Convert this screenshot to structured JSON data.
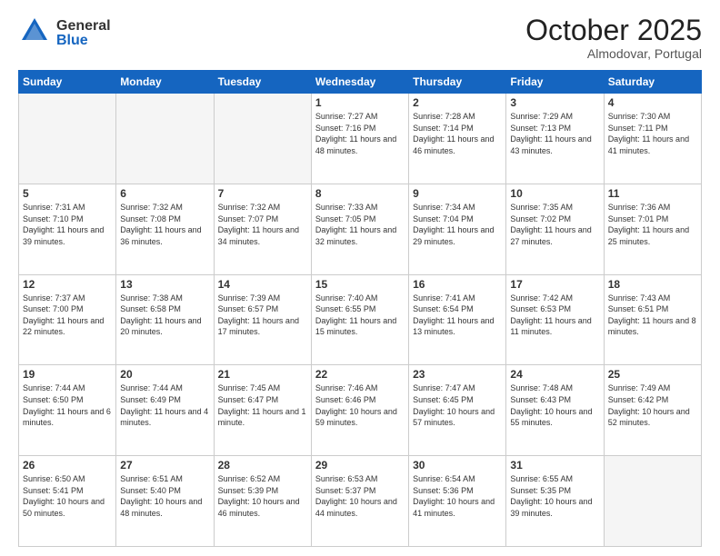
{
  "header": {
    "logo_general": "General",
    "logo_blue": "Blue",
    "month": "October 2025",
    "location": "Almodovar, Portugal"
  },
  "days_of_week": [
    "Sunday",
    "Monday",
    "Tuesday",
    "Wednesday",
    "Thursday",
    "Friday",
    "Saturday"
  ],
  "weeks": [
    [
      {
        "day": "",
        "info": ""
      },
      {
        "day": "",
        "info": ""
      },
      {
        "day": "",
        "info": ""
      },
      {
        "day": "1",
        "info": "Sunrise: 7:27 AM\nSunset: 7:16 PM\nDaylight: 11 hours and 48 minutes."
      },
      {
        "day": "2",
        "info": "Sunrise: 7:28 AM\nSunset: 7:14 PM\nDaylight: 11 hours and 46 minutes."
      },
      {
        "day": "3",
        "info": "Sunrise: 7:29 AM\nSunset: 7:13 PM\nDaylight: 11 hours and 43 minutes."
      },
      {
        "day": "4",
        "info": "Sunrise: 7:30 AM\nSunset: 7:11 PM\nDaylight: 11 hours and 41 minutes."
      }
    ],
    [
      {
        "day": "5",
        "info": "Sunrise: 7:31 AM\nSunset: 7:10 PM\nDaylight: 11 hours and 39 minutes."
      },
      {
        "day": "6",
        "info": "Sunrise: 7:32 AM\nSunset: 7:08 PM\nDaylight: 11 hours and 36 minutes."
      },
      {
        "day": "7",
        "info": "Sunrise: 7:32 AM\nSunset: 7:07 PM\nDaylight: 11 hours and 34 minutes."
      },
      {
        "day": "8",
        "info": "Sunrise: 7:33 AM\nSunset: 7:05 PM\nDaylight: 11 hours and 32 minutes."
      },
      {
        "day": "9",
        "info": "Sunrise: 7:34 AM\nSunset: 7:04 PM\nDaylight: 11 hours and 29 minutes."
      },
      {
        "day": "10",
        "info": "Sunrise: 7:35 AM\nSunset: 7:02 PM\nDaylight: 11 hours and 27 minutes."
      },
      {
        "day": "11",
        "info": "Sunrise: 7:36 AM\nSunset: 7:01 PM\nDaylight: 11 hours and 25 minutes."
      }
    ],
    [
      {
        "day": "12",
        "info": "Sunrise: 7:37 AM\nSunset: 7:00 PM\nDaylight: 11 hours and 22 minutes."
      },
      {
        "day": "13",
        "info": "Sunrise: 7:38 AM\nSunset: 6:58 PM\nDaylight: 11 hours and 20 minutes."
      },
      {
        "day": "14",
        "info": "Sunrise: 7:39 AM\nSunset: 6:57 PM\nDaylight: 11 hours and 17 minutes."
      },
      {
        "day": "15",
        "info": "Sunrise: 7:40 AM\nSunset: 6:55 PM\nDaylight: 11 hours and 15 minutes."
      },
      {
        "day": "16",
        "info": "Sunrise: 7:41 AM\nSunset: 6:54 PM\nDaylight: 11 hours and 13 minutes."
      },
      {
        "day": "17",
        "info": "Sunrise: 7:42 AM\nSunset: 6:53 PM\nDaylight: 11 hours and 11 minutes."
      },
      {
        "day": "18",
        "info": "Sunrise: 7:43 AM\nSunset: 6:51 PM\nDaylight: 11 hours and 8 minutes."
      }
    ],
    [
      {
        "day": "19",
        "info": "Sunrise: 7:44 AM\nSunset: 6:50 PM\nDaylight: 11 hours and 6 minutes."
      },
      {
        "day": "20",
        "info": "Sunrise: 7:44 AM\nSunset: 6:49 PM\nDaylight: 11 hours and 4 minutes."
      },
      {
        "day": "21",
        "info": "Sunrise: 7:45 AM\nSunset: 6:47 PM\nDaylight: 11 hours and 1 minute."
      },
      {
        "day": "22",
        "info": "Sunrise: 7:46 AM\nSunset: 6:46 PM\nDaylight: 10 hours and 59 minutes."
      },
      {
        "day": "23",
        "info": "Sunrise: 7:47 AM\nSunset: 6:45 PM\nDaylight: 10 hours and 57 minutes."
      },
      {
        "day": "24",
        "info": "Sunrise: 7:48 AM\nSunset: 6:43 PM\nDaylight: 10 hours and 55 minutes."
      },
      {
        "day": "25",
        "info": "Sunrise: 7:49 AM\nSunset: 6:42 PM\nDaylight: 10 hours and 52 minutes."
      }
    ],
    [
      {
        "day": "26",
        "info": "Sunrise: 6:50 AM\nSunset: 5:41 PM\nDaylight: 10 hours and 50 minutes."
      },
      {
        "day": "27",
        "info": "Sunrise: 6:51 AM\nSunset: 5:40 PM\nDaylight: 10 hours and 48 minutes."
      },
      {
        "day": "28",
        "info": "Sunrise: 6:52 AM\nSunset: 5:39 PM\nDaylight: 10 hours and 46 minutes."
      },
      {
        "day": "29",
        "info": "Sunrise: 6:53 AM\nSunset: 5:37 PM\nDaylight: 10 hours and 44 minutes."
      },
      {
        "day": "30",
        "info": "Sunrise: 6:54 AM\nSunset: 5:36 PM\nDaylight: 10 hours and 41 minutes."
      },
      {
        "day": "31",
        "info": "Sunrise: 6:55 AM\nSunset: 5:35 PM\nDaylight: 10 hours and 39 minutes."
      },
      {
        "day": "",
        "info": ""
      }
    ]
  ]
}
